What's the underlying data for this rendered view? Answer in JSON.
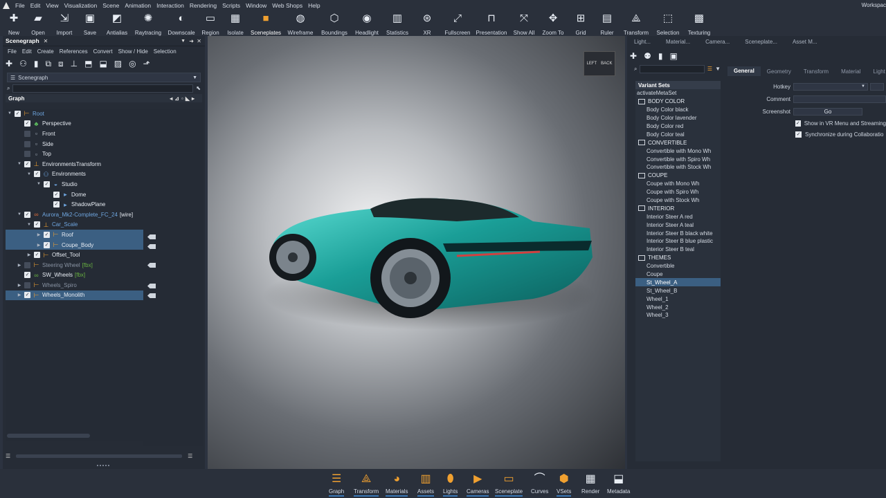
{
  "menubar": {
    "items": [
      "File",
      "Edit",
      "View",
      "Visualization",
      "Scene",
      "Animation",
      "Interaction",
      "Rendering",
      "Scripts",
      "Window",
      "Web Shops",
      "Help"
    ],
    "workspace": "Workspac"
  },
  "toolbar": {
    "items": [
      {
        "label": "New",
        "icon": "new-file-icon"
      },
      {
        "label": "Open",
        "icon": "folder-open-icon"
      },
      {
        "label": "Import",
        "icon": "import-icon"
      },
      {
        "label": "Save",
        "icon": "save-icon"
      },
      {
        "label": "Antialias",
        "icon": "antialias-icon"
      },
      {
        "label": "Raytracing",
        "icon": "raytracing-icon"
      },
      {
        "label": "Downscale",
        "icon": "downscale-icon"
      },
      {
        "label": "Region",
        "icon": "region-icon"
      },
      {
        "label": "Isolate",
        "icon": "isolate-icon"
      },
      {
        "label": "Sceneplates",
        "icon": "sceneplates-icon"
      },
      {
        "label": "Wireframe",
        "icon": "wireframe-icon"
      },
      {
        "label": "Boundings",
        "icon": "boundings-icon"
      },
      {
        "label": "Headlight",
        "icon": "headlight-icon"
      },
      {
        "label": "Statistics",
        "icon": "statistics-icon"
      },
      {
        "label": "XR",
        "icon": "xr-icon"
      },
      {
        "label": "Fullscreen",
        "icon": "fullscreen-icon"
      },
      {
        "label": "Presentation",
        "icon": "presentation-icon"
      },
      {
        "label": "Show All",
        "icon": "show-all-icon"
      },
      {
        "label": "Zoom To",
        "icon": "zoom-to-icon"
      },
      {
        "label": "Grid",
        "icon": "grid-icon"
      },
      {
        "label": "Ruler",
        "icon": "ruler-icon"
      },
      {
        "label": "Transform",
        "icon": "transform-icon"
      },
      {
        "label": "Selection",
        "icon": "selection-icon"
      },
      {
        "label": "Texturing",
        "icon": "texturing-icon"
      }
    ],
    "active": "Sceneplates"
  },
  "scenegraph": {
    "title": "Scenegraph",
    "menu": [
      "File",
      "Edit",
      "Create",
      "References",
      "Convert",
      "Show / Hide",
      "Selection"
    ],
    "dropdown": "Scenegraph",
    "graph_header": "Graph",
    "nodes": [
      {
        "label": "Root",
        "tag": ""
      },
      {
        "label": "Perspective",
        "tag": ""
      },
      {
        "label": "Front",
        "tag": ""
      },
      {
        "label": "Side",
        "tag": ""
      },
      {
        "label": "Top",
        "tag": ""
      },
      {
        "label": "EnvironmentsTransform",
        "tag": ""
      },
      {
        "label": "Environments",
        "tag": ""
      },
      {
        "label": "Studio",
        "tag": ""
      },
      {
        "label": "Dome",
        "tag": ""
      },
      {
        "label": "ShadowPlane",
        "tag": ""
      },
      {
        "label": "Aurora_Mk2-Complete_FC_24",
        "tag": "[wire]"
      },
      {
        "label": "Car_Scale",
        "tag": ""
      },
      {
        "label": "Roof",
        "tag": ""
      },
      {
        "label": "Coupe_Body",
        "tag": ""
      },
      {
        "label": "Offset_Tool",
        "tag": ""
      },
      {
        "label": "Steering Wheel",
        "tag": "[fbx]"
      },
      {
        "label": "SW_Wheels",
        "tag": "[fbx]"
      },
      {
        "label": "Wheels_Spiro",
        "tag": ""
      },
      {
        "label": "Wheels_Monolith",
        "tag": ""
      }
    ]
  },
  "viewport": {
    "cube_left": "LEFT",
    "cube_back": "BACK"
  },
  "right_tabs": [
    "Light...",
    "Material...",
    "Camera...",
    "Sceneplate...",
    "Asset M..."
  ],
  "variants": {
    "header": "Variant Sets",
    "root": "activateMetaSet",
    "groups": [
      {
        "name": "BODY COLOR",
        "items": [
          "Body Color black",
          "Body Color lavender",
          "Body Color red",
          "Body Color teal"
        ]
      },
      {
        "name": "CONVERTIBLE",
        "items": [
          "Convertible with Mono Wh",
          "Convertible with Spiro Wh",
          "Convertible with Stock Wh"
        ]
      },
      {
        "name": "COUPE",
        "items": [
          "Coupe with Mono Wh",
          "Coupe with Spiro Wh",
          "Coupe with Stock Wh"
        ]
      },
      {
        "name": "INTERIOR",
        "items": [
          "Interior Steer A red",
          "Interior Steer A teal",
          "Interior Steer B black white",
          "Interior Steer B blue plastic",
          "Interior Steer B teal"
        ]
      },
      {
        "name": "THEMES",
        "items": [
          "Convertible",
          "Coupe",
          "St_Wheel_A",
          "St_Wheel_B",
          "Wheel_1",
          "Wheel_2",
          "Wheel_3"
        ]
      }
    ],
    "selected": "St_Wheel_A"
  },
  "properties": {
    "tabs": [
      "General",
      "Geometry",
      "Transform",
      "Material",
      "Light"
    ],
    "active_tab": "General",
    "hotkey_label": "Hotkey",
    "comment_label": "Comment",
    "screenshot_label": "Screenshot",
    "go_button": "Go",
    "check1": "Show in VR Menu and Streaming",
    "check2": "Synchronize during Collaboratio"
  },
  "bottombar": {
    "items": [
      {
        "label": "Graph",
        "icon": "graph-icon"
      },
      {
        "label": "Transform",
        "icon": "transform-icon"
      },
      {
        "label": "Materials",
        "icon": "materials-icon"
      },
      {
        "label": "Assets",
        "icon": "assets-icon"
      },
      {
        "label": "Lights",
        "icon": "lights-icon"
      },
      {
        "label": "Cameras",
        "icon": "cameras-icon"
      },
      {
        "label": "Sceneplate",
        "icon": "sceneplate-icon"
      },
      {
        "label": "Curves",
        "icon": "curves-icon"
      },
      {
        "label": "VSets",
        "icon": "vsets-icon"
      },
      {
        "label": "Render",
        "icon": "render-icon"
      },
      {
        "label": "Metadata",
        "icon": "metadata-icon"
      }
    ]
  },
  "colors": {
    "accent": "#f0a030",
    "selection": "#3b5f82",
    "car": "#1a9e97"
  }
}
